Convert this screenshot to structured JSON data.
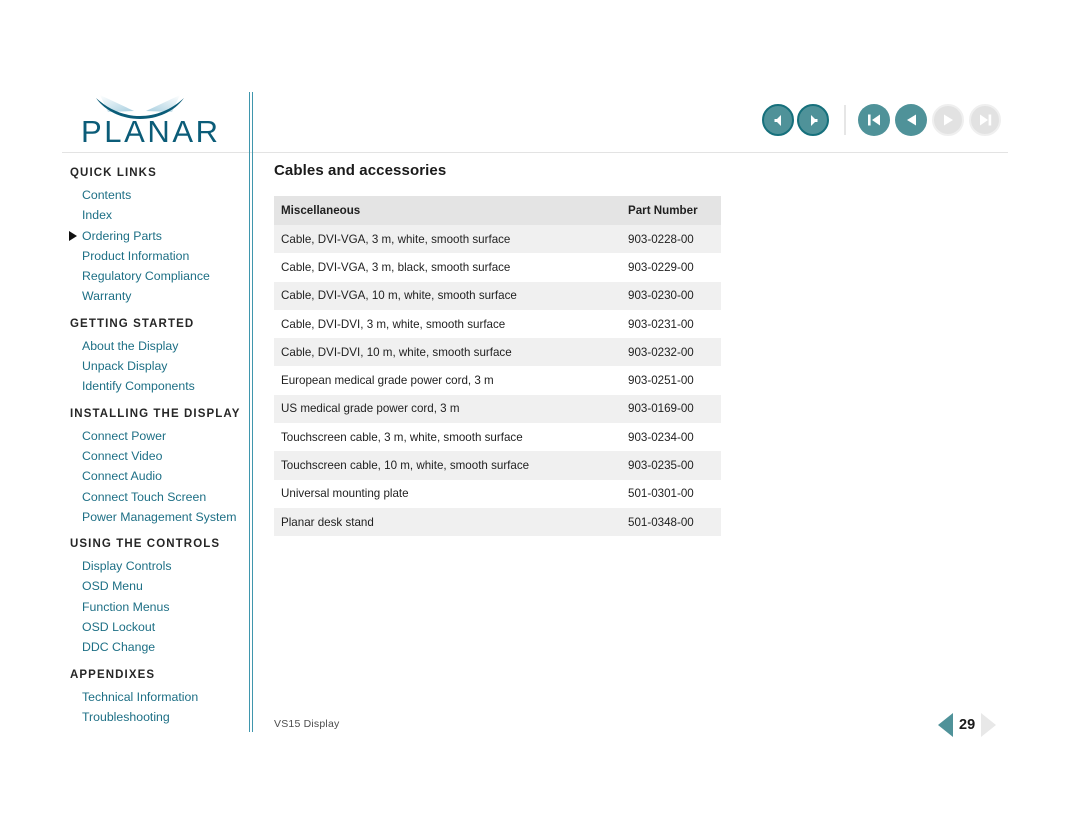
{
  "brand": {
    "logo_text": "PLANAR",
    "logo_name": "planar-logo"
  },
  "topnav": {
    "back_label": "back-arrow",
    "forward_label": "forward-arrow",
    "first_page_label": "first-page",
    "prev_page_label": "previous-page",
    "next_page_label": "next-page",
    "last_page_label": "last-page"
  },
  "sidebar": {
    "sections": [
      {
        "heading": "QUICK LINKS",
        "items": [
          {
            "label": "Contents",
            "current": false
          },
          {
            "label": "Index",
            "current": false
          },
          {
            "label": "Ordering Parts",
            "current": true
          },
          {
            "label": "Product Information",
            "current": false
          },
          {
            "label": "Regulatory Compliance",
            "current": false
          },
          {
            "label": "Warranty",
            "current": false
          }
        ]
      },
      {
        "heading": "GETTING STARTED",
        "items": [
          {
            "label": "About the Display",
            "current": false
          },
          {
            "label": "Unpack Display",
            "current": false
          },
          {
            "label": "Identify Components",
            "current": false
          }
        ]
      },
      {
        "heading": "INSTALLING THE DISPLAY",
        "items": [
          {
            "label": "Connect Power",
            "current": false
          },
          {
            "label": "Connect Video",
            "current": false
          },
          {
            "label": "Connect Audio",
            "current": false
          },
          {
            "label": "Connect Touch Screen",
            "current": false
          },
          {
            "label": "Power Management System",
            "current": false
          }
        ]
      },
      {
        "heading": "USING THE CONTROLS",
        "items": [
          {
            "label": "Display Controls",
            "current": false
          },
          {
            "label": "OSD Menu",
            "current": false
          },
          {
            "label": "Function Menus",
            "current": false
          },
          {
            "label": "OSD Lockout",
            "current": false
          },
          {
            "label": "DDC Change",
            "current": false
          }
        ]
      },
      {
        "heading": "APPENDIXES",
        "items": [
          {
            "label": "Technical Information",
            "current": false
          },
          {
            "label": "Troubleshooting",
            "current": false
          }
        ]
      }
    ]
  },
  "main": {
    "title": "Cables and accessories",
    "table": {
      "headers": [
        "Miscellaneous",
        "Part Number"
      ],
      "rows": [
        [
          "Cable, DVI-VGA, 3 m, white, smooth surface",
          "903-0228-00"
        ],
        [
          "Cable, DVI-VGA, 3 m, black, smooth surface",
          "903-0229-00"
        ],
        [
          "Cable, DVI-VGA, 10 m, white, smooth surface",
          "903-0230-00"
        ],
        [
          "Cable, DVI-DVI, 3 m, white, smooth surface",
          "903-0231-00"
        ],
        [
          "Cable, DVI-DVI, 10 m, white, smooth surface",
          "903-0232-00"
        ],
        [
          "European medical grade power cord, 3 m",
          "903-0251-00"
        ],
        [
          "US medical grade power cord, 3 m",
          "903-0169-00"
        ],
        [
          "Touchscreen cable, 3 m, white, smooth surface",
          "903-0234-00"
        ],
        [
          "Touchscreen cable, 10 m, white, smooth surface",
          "903-0235-00"
        ],
        [
          "Universal mounting plate",
          "501-0301-00"
        ],
        [
          "Planar desk stand",
          "501-0348-00"
        ]
      ]
    }
  },
  "footer": {
    "document_label": "VS15 Display",
    "page_number": "29"
  },
  "colors": {
    "teal": "#4f9299",
    "teal_dark": "#16707c",
    "link": "#1d6f85",
    "logo_blue": "#0b5c78",
    "row_shade": "#f0f0f0",
    "header_shade": "#e4e4e4",
    "disabled_gray": "#e2e2e2"
  }
}
